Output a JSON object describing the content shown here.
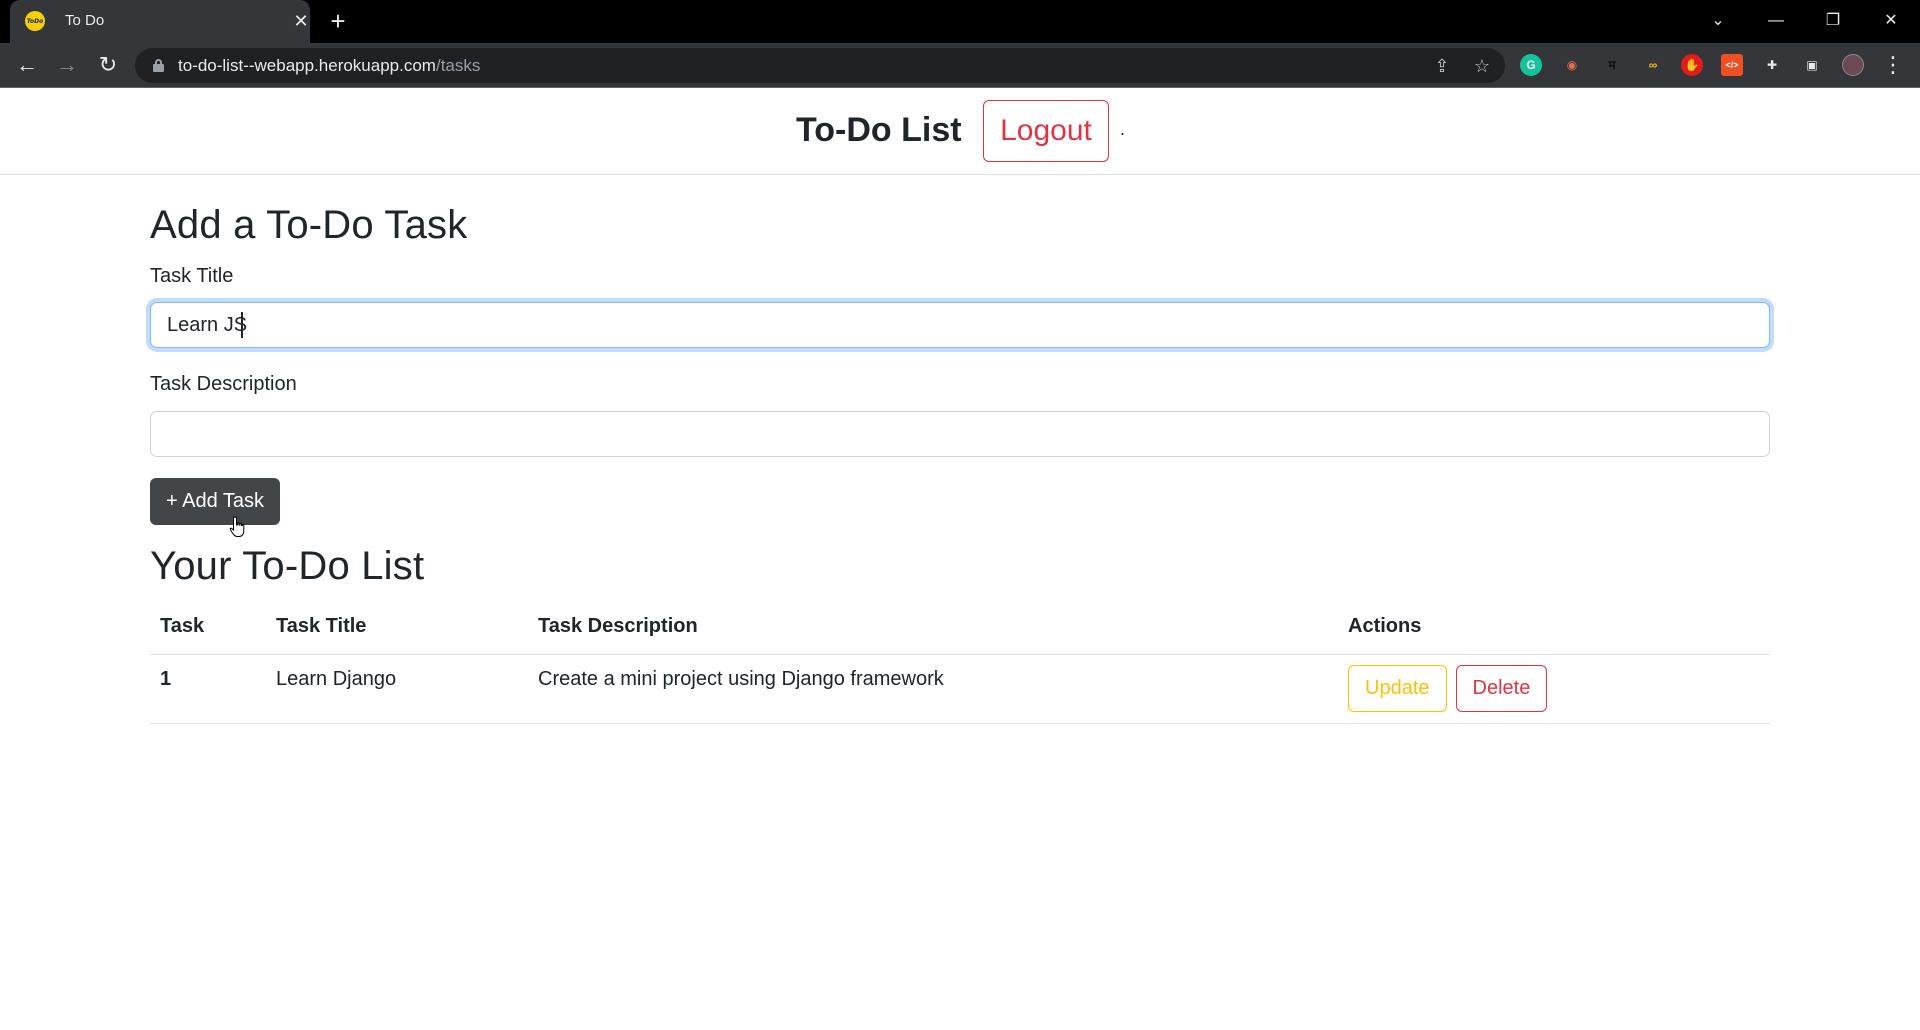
{
  "browser": {
    "tab_title": "To Do",
    "favicon_text": "ToDo",
    "url_host": "to-do-list--webapp.herokuapp.com",
    "url_path": "/tasks",
    "icons": {
      "tab_close": "✕",
      "new_tab": "+",
      "tab_search": "⌄",
      "minimize": "—",
      "restore": "❐",
      "close": "✕",
      "back": "←",
      "forward": "→",
      "reload": "↻",
      "share": "⇪",
      "bookmark": "☆",
      "menu": "⋮"
    },
    "extensions": [
      {
        "name": "grammarly",
        "glyph": "G",
        "bg": "#15c39a",
        "fg": "#ffffff"
      },
      {
        "name": "ghost-ext",
        "glyph": "◉",
        "bg": "#35363a",
        "fg": "#e76f51"
      },
      {
        "name": "hindi-ext",
        "glyph": "म",
        "bg": "#35363a",
        "fg": "#111111"
      },
      {
        "name": "infinity-ext",
        "glyph": "∞",
        "bg": "#35363a",
        "fg": "#f5c400"
      },
      {
        "name": "adblock",
        "glyph": "✋",
        "bg": "#e21b1b",
        "fg": "#ffffff"
      },
      {
        "name": "code-ext",
        "glyph": "</>",
        "bg": "#f04e23",
        "fg": "#ffffff"
      },
      {
        "name": "extensions-puzzle",
        "glyph": "✚",
        "bg": "#35363a",
        "fg": "#e8eaed"
      },
      {
        "name": "side-panel",
        "glyph": "▣",
        "bg": "#35363a",
        "fg": "#e8eaed"
      }
    ]
  },
  "header": {
    "brand": "To-Do List",
    "logout_label": "Logout",
    "trailing_text": "."
  },
  "form": {
    "title": "Add a To-Do Task",
    "task_title_label": "Task Title",
    "task_title_value": "Learn JS",
    "task_description_label": "Task Description",
    "task_description_value": "",
    "add_button_label": "+ Add Task"
  },
  "list": {
    "title": "Your To-Do List",
    "columns": [
      "Task",
      "Task Title",
      "Task Description",
      "Actions"
    ],
    "rows": [
      {
        "number": "1",
        "title": "Learn Django",
        "description": "Create a mini project using Django framework",
        "update_label": "Update",
        "delete_label": "Delete"
      }
    ]
  },
  "colors": {
    "danger": "#dc3545",
    "warning": "#ffc107",
    "dark_button": "#424649",
    "focus_ring": "#86b7fe"
  }
}
